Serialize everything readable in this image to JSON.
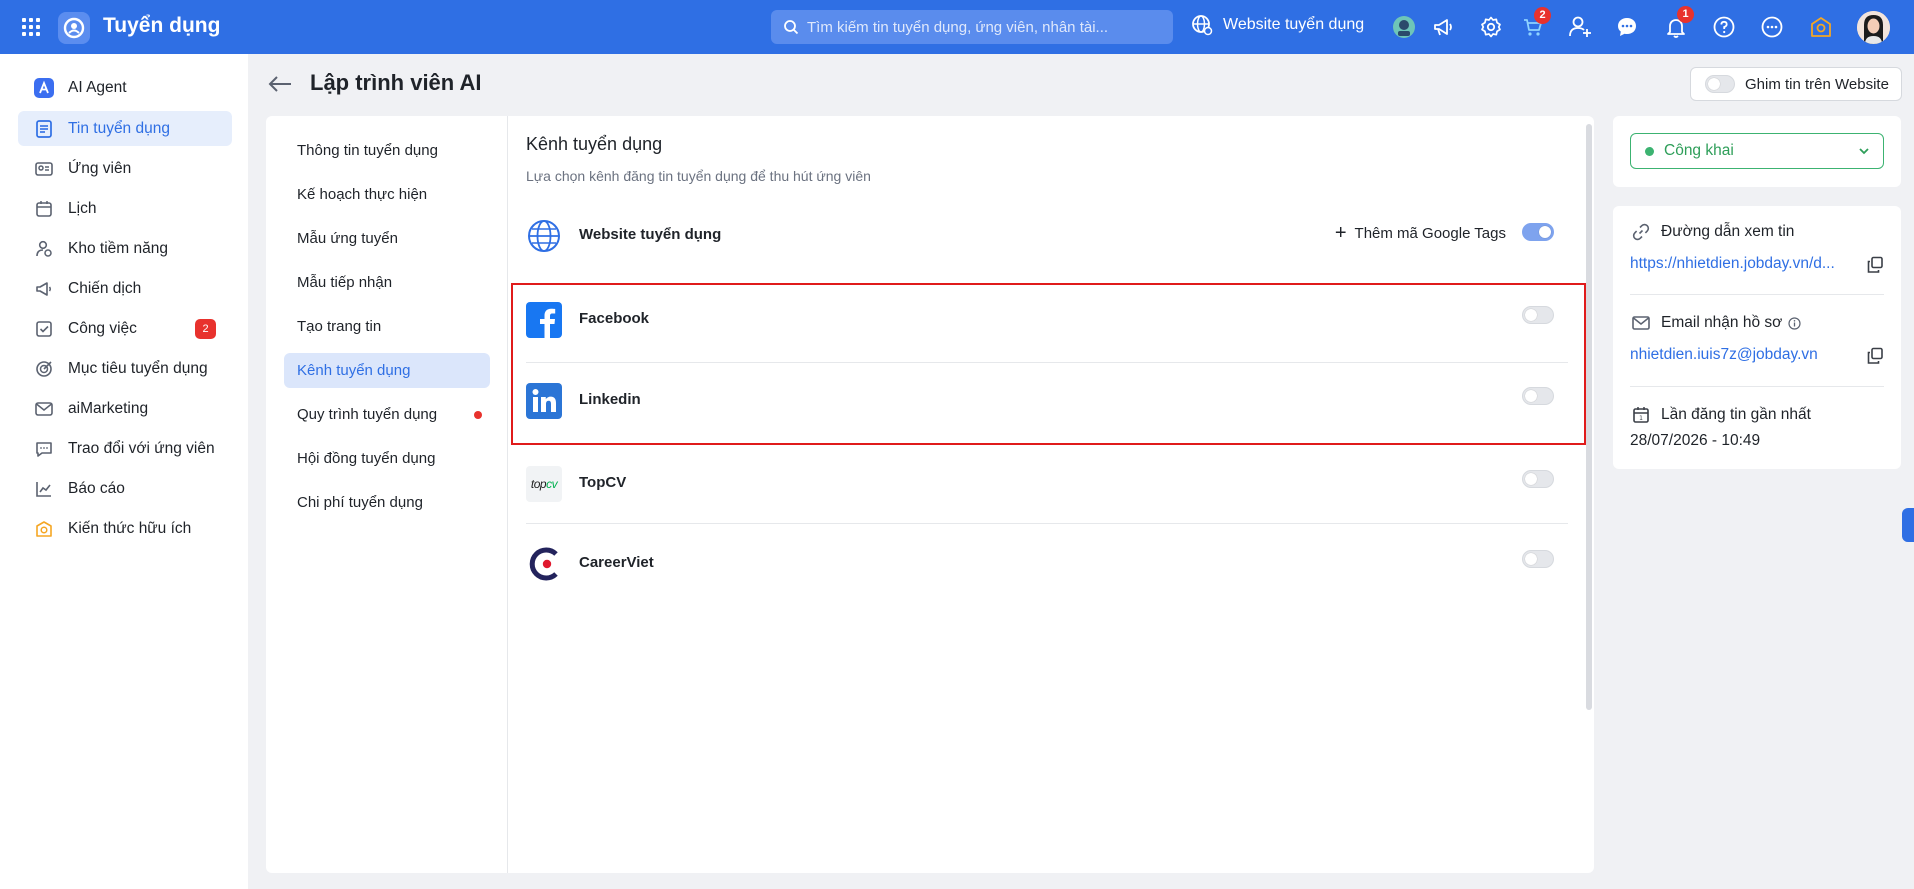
{
  "app": {
    "title": "Tuyển dụng"
  },
  "topbar": {
    "search_placeholder": "Tìm kiếm tin tuyển dụng, ứng viên, nhân tài...",
    "website_label": "Website tuyển dụng",
    "cart_badge": "2",
    "notification_badge": "1"
  },
  "sidebar": {
    "items": [
      {
        "label": "AI Agent",
        "icon": "ai-agent-icon"
      },
      {
        "label": "Tin tuyển dụng",
        "icon": "job-post-icon",
        "active": true
      },
      {
        "label": "Ứng viên",
        "icon": "candidate-icon"
      },
      {
        "label": "Lịch",
        "icon": "calendar-icon"
      },
      {
        "label": "Kho tiềm năng",
        "icon": "talent-pool-icon"
      },
      {
        "label": "Chiến dịch",
        "icon": "campaign-icon"
      },
      {
        "label": "Công việc",
        "icon": "task-icon",
        "badge": "2"
      },
      {
        "label": "Mục tiêu tuyển dụng",
        "icon": "target-icon"
      },
      {
        "label": "aiMarketing",
        "icon": "mail-icon"
      },
      {
        "label": "Trao đổi với ứng viên",
        "icon": "chat-icon"
      },
      {
        "label": "Báo cáo",
        "icon": "report-icon"
      },
      {
        "label": "Kiến thức hữu ích",
        "icon": "knowledge-icon"
      }
    ]
  },
  "page": {
    "title": "Lập trình viên AI",
    "pin_label": "Ghim tin trên Website"
  },
  "subnav": {
    "items": [
      {
        "label": "Thông tin tuyển dụng"
      },
      {
        "label": "Kế hoạch thực hiện"
      },
      {
        "label": "Mẫu ứng tuyển"
      },
      {
        "label": "Mẫu tiếp nhận"
      },
      {
        "label": "Tạo trang tin"
      },
      {
        "label": "Kênh tuyển dụng",
        "active": true
      },
      {
        "label": "Quy trình tuyển dụng",
        "dot": true
      },
      {
        "label": "Hội đồng tuyển dụng"
      },
      {
        "label": "Chi phí tuyển dụng"
      }
    ]
  },
  "channels": {
    "title": "Kênh tuyển dụng",
    "subtitle": "Lựa chọn kênh đăng tin tuyển dụng để thu hút ứng viên",
    "google_tags_label": "Thêm mã Google Tags",
    "items": [
      {
        "name": "Website tuyển dụng",
        "enabled": true
      },
      {
        "name": "Facebook",
        "enabled": false
      },
      {
        "name": "Linkedin",
        "enabled": false
      },
      {
        "name": "TopCV",
        "enabled": false,
        "logo_text": "topcv"
      },
      {
        "name": "CareerViet",
        "enabled": false
      }
    ]
  },
  "right_panel": {
    "status": "Công khai",
    "link_label": "Đường dẫn xem tin",
    "link_value": "https://nhietdien.jobday.vn/d...",
    "email_label": "Email nhận hồ sơ",
    "email_value": "nhietdien.iuis7z@jobday.vn",
    "last_post_label": "Lần đăng tin gần nhất",
    "last_post_value": "28/07/2026 - 10:49"
  },
  "colors": {
    "primary": "#2f6fe4",
    "success": "#3cb371",
    "danger": "#e8322d"
  }
}
